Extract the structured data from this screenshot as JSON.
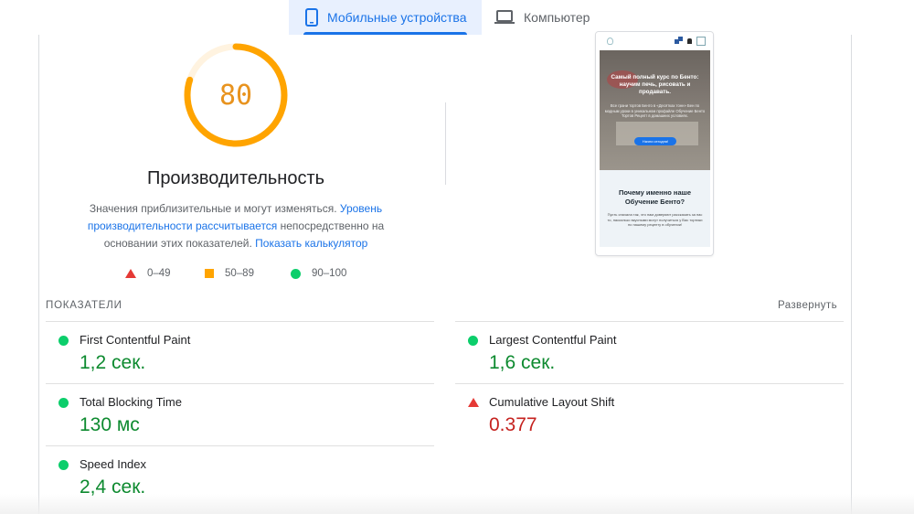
{
  "tabs": {
    "mobile": "Мобильные устройства",
    "desktop": "Компьютер"
  },
  "performance": {
    "score": "80",
    "score_value": 80,
    "title": "Производительность",
    "description_prefix": "Значения приблизительные и могут изменяться. ",
    "link_level": "Уровень производительности рассчитывается",
    "description_middle": " непосредственно на основании этих показателей. ",
    "link_calculator": "Показать калькулятор",
    "gauge_color": "#ffa400",
    "gauge_track_color": "#fff3e0"
  },
  "legend": {
    "fail": "0–49",
    "average": "50–89",
    "pass": "90–100"
  },
  "colors": {
    "fail": "#e53935",
    "average": "#ffa400",
    "pass": "#0cce6b",
    "accent": "#1a73e8"
  },
  "preview": {
    "hero_title": "Самый полный курс по Бенто: научим печь, рисовать и продавать.",
    "hero_subtitle": "Все грани тортов Бенто в «Десятках тонн» Бен по модным уроки в уникальном профайле Обучение Бенто Тортов Рецепт в домашних условиях.",
    "hero_button": "Начни сегодня!",
    "section_title": "Почему именно наше Обучение Бенто?",
    "section_text": "Пусть сначала так, что нам доверяют рассказать за нас то, насколько вкусными могут получиться у Вас тортики по нашему рецепту в обучении!"
  },
  "metrics": {
    "header": "ПОКАЗАТЕЛИ",
    "expand": "Развернуть",
    "items": [
      {
        "title": "First Contentful Paint",
        "value": "1,2 сек.",
        "status": "pass"
      },
      {
        "title": "Largest Contentful Paint",
        "value": "1,6 сек.",
        "status": "pass"
      },
      {
        "title": "Total Blocking Time",
        "value": "130 мс",
        "status": "pass"
      },
      {
        "title": "Cumulative Layout Shift",
        "value": "0.377",
        "status": "fail"
      },
      {
        "title": "Speed Index",
        "value": "2,4 сек.",
        "status": "pass"
      }
    ]
  }
}
